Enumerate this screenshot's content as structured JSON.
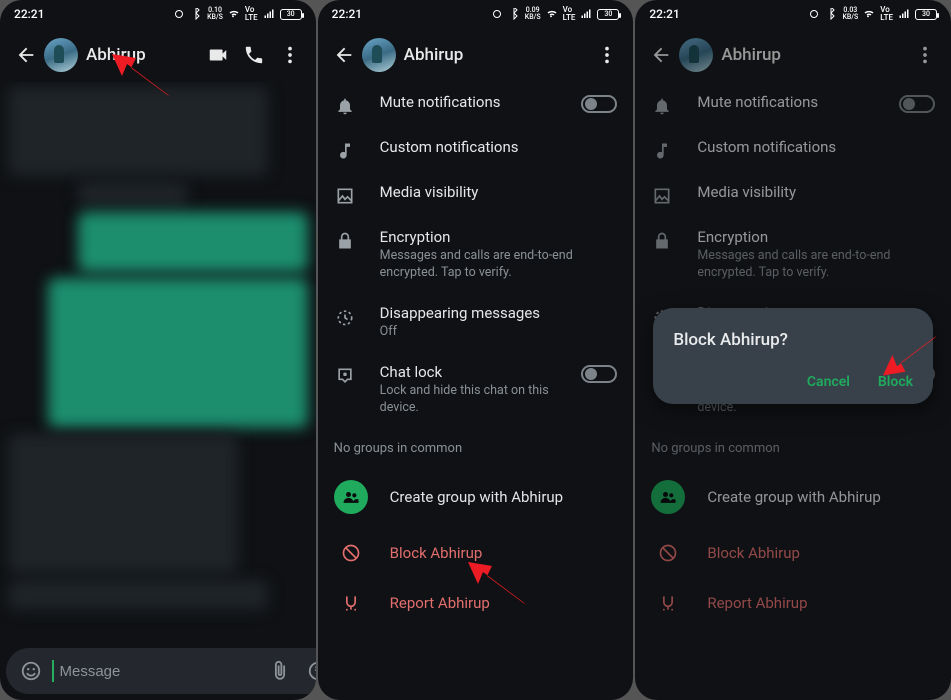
{
  "status": {
    "time": "22:21",
    "alarm": true,
    "bt": true,
    "battery": "30"
  },
  "p1": {
    "speed": "0.10",
    "speed_unit": "KB/S",
    "contact": "Abhirup",
    "msg_placeholder": "Message"
  },
  "p2": {
    "speed": "0.09",
    "speed_unit": "KB/S",
    "contact": "Abhirup",
    "mute": "Mute notifications",
    "custom": "Custom notifications",
    "media": "Media visibility",
    "enc_t": "Encryption",
    "enc_s": "Messages and calls are end-to-end encrypted. Tap to verify.",
    "disappear_t": "Disappearing messages",
    "disappear_s": "Off",
    "lock_t": "Chat lock",
    "lock_s": "Lock and hide this chat on this device.",
    "groups": "No groups in common",
    "create": "Create group with Abhirup",
    "block": "Block Abhirup",
    "report": "Report Abhirup"
  },
  "p3": {
    "speed": "0.03",
    "speed_unit": "KB/S",
    "contact": "Abhirup",
    "dialog_title": "Block Abhirup?",
    "dialog_cancel": "Cancel",
    "dialog_block": "Block"
  }
}
